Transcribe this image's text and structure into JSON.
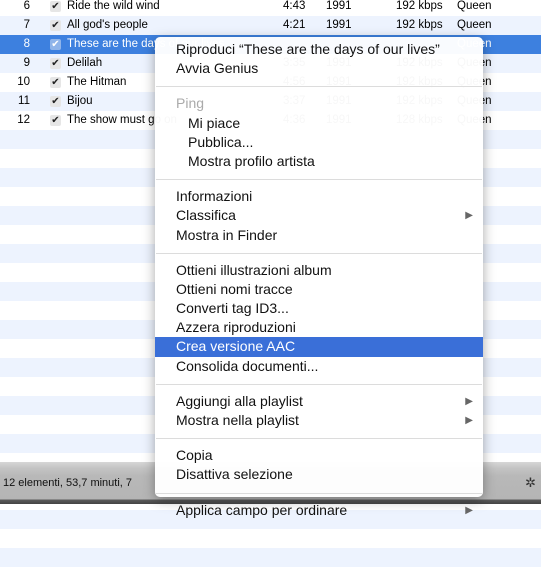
{
  "tracks": [
    {
      "num": "6",
      "title": "Ride the wild wind",
      "time": "4:43",
      "year": "1991",
      "rate": "192 kbps",
      "artist": "Queen"
    },
    {
      "num": "7",
      "title": "All god's people",
      "time": "4:21",
      "year": "1991",
      "rate": "192 kbps",
      "artist": "Queen"
    },
    {
      "num": "8",
      "title": "These are the days of our lives",
      "time": "",
      "year": "",
      "rate": "",
      "artist": "Queen"
    },
    {
      "num": "9",
      "title": "Delilah",
      "time": "3:35",
      "year": "1991",
      "rate": "192 kbps",
      "artist": "Queen"
    },
    {
      "num": "10",
      "title": "The Hitman",
      "time": "4:56",
      "year": "1991",
      "rate": "192 kbps",
      "artist": "Queen"
    },
    {
      "num": "11",
      "title": "Bijou",
      "time": "3:37",
      "year": "1991",
      "rate": "192 kbps",
      "artist": "Queen"
    },
    {
      "num": "12",
      "title": "The show must go on",
      "time": "4:36",
      "year": "1991",
      "rate": "128 kbps",
      "artist": "Queen"
    }
  ],
  "check": "✔",
  "status": "12 elementi, 53,7 minuti, 7",
  "accent": "#3d80df",
  "menu": [
    {
      "label": "Riproduci “These are the days of our lives”"
    },
    {
      "label": "Avvia Genius"
    },
    {
      "sep": true
    },
    {
      "label": "Ping",
      "disabled": true
    },
    {
      "label": "Mi piace",
      "indent": true
    },
    {
      "label": "Pubblica...",
      "indent": true
    },
    {
      "label": "Mostra profilo artista",
      "indent": true
    },
    {
      "sep": true
    },
    {
      "label": "Informazioni"
    },
    {
      "label": "Classifica",
      "submenu": true
    },
    {
      "label": "Mostra in Finder"
    },
    {
      "sep": true
    },
    {
      "label": "Ottieni illustrazioni album"
    },
    {
      "label": "Ottieni nomi tracce"
    },
    {
      "label": "Converti tag ID3..."
    },
    {
      "label": "Azzera riproduzioni"
    },
    {
      "label": "Crea versione AAC",
      "highlighted": true
    },
    {
      "label": "Consolida documenti..."
    },
    {
      "sep": true
    },
    {
      "label": "Aggiungi alla playlist",
      "submenu": true
    },
    {
      "label": "Mostra nella playlist",
      "submenu": true
    },
    {
      "sep": true
    },
    {
      "label": "Copia"
    },
    {
      "label": "Disattiva selezione"
    },
    {
      "sep": true
    },
    {
      "label": "Applica campo per ordinare",
      "submenu": true
    }
  ]
}
